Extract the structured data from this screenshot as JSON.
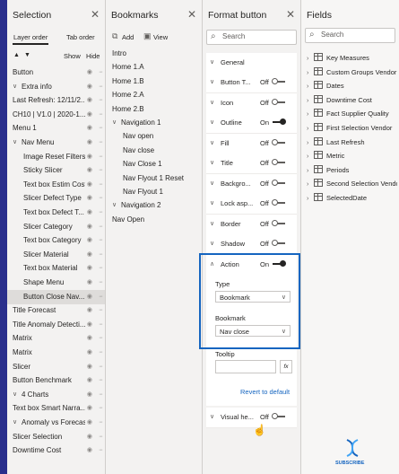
{
  "selection": {
    "title": "Selection",
    "tabs": [
      "Layer order",
      "Tab order"
    ],
    "show_label": "Show",
    "hide_label": "Hide",
    "items": [
      {
        "label": "Button",
        "indent": 0,
        "chev": ""
      },
      {
        "label": "Extra info",
        "indent": 0,
        "chev": "v"
      },
      {
        "label": "Last Refresh: 12/11/2...",
        "indent": 0,
        "chev": ""
      },
      {
        "label": "CH10 | V1.0 | 2020-1...",
        "indent": 0,
        "chev": ""
      },
      {
        "label": "Menu 1",
        "indent": 0,
        "chev": ""
      },
      {
        "label": "Nav Menu",
        "indent": 0,
        "chev": "v"
      },
      {
        "label": "Image Reset Filters",
        "indent": 1,
        "chev": ""
      },
      {
        "label": "Sticky Slicer",
        "indent": 1,
        "chev": ""
      },
      {
        "label": "Text box Estim Cost",
        "indent": 1,
        "chev": ""
      },
      {
        "label": "Slicer Defect Type",
        "indent": 1,
        "chev": ""
      },
      {
        "label": "Text box Defect T...",
        "indent": 1,
        "chev": ""
      },
      {
        "label": "Slicer Category",
        "indent": 1,
        "chev": ""
      },
      {
        "label": "Text box Category",
        "indent": 1,
        "chev": ""
      },
      {
        "label": "Slicer Material",
        "indent": 1,
        "chev": ""
      },
      {
        "label": "Text box Material",
        "indent": 1,
        "chev": ""
      },
      {
        "label": "Shape Menu",
        "indent": 1,
        "chev": ""
      },
      {
        "label": "Button Close Nav...",
        "indent": 1,
        "chev": "",
        "selected": true
      },
      {
        "label": "Title Forecast",
        "indent": 0,
        "chev": ""
      },
      {
        "label": "Title Anomaly Detecti...",
        "indent": 0,
        "chev": ""
      },
      {
        "label": "Matrix",
        "indent": 0,
        "chev": ""
      },
      {
        "label": "Matrix",
        "indent": 0,
        "chev": ""
      },
      {
        "label": "Slicer",
        "indent": 0,
        "chev": ""
      },
      {
        "label": "Button Benchmark",
        "indent": 0,
        "chev": ""
      },
      {
        "label": "4 Charts",
        "indent": 0,
        "chev": "v"
      },
      {
        "label": "Text box Smart Narra...",
        "indent": 0,
        "chev": ""
      },
      {
        "label": "Anomaly vs Forecast",
        "indent": 0,
        "chev": "v"
      },
      {
        "label": "Slicer Selection",
        "indent": 0,
        "chev": ""
      },
      {
        "label": "Downtime Cost",
        "indent": 0,
        "chev": ""
      }
    ]
  },
  "bookmarks": {
    "title": "Bookmarks",
    "add_label": "Add",
    "view_label": "View",
    "items": [
      {
        "label": "Intro",
        "indent": 0,
        "chev": ""
      },
      {
        "label": "Home 1.A",
        "indent": 0,
        "chev": ""
      },
      {
        "label": "Home 1.B",
        "indent": 0,
        "chev": ""
      },
      {
        "label": "Home 2.A",
        "indent": 0,
        "chev": ""
      },
      {
        "label": "Home 2.B",
        "indent": 0,
        "chev": ""
      },
      {
        "label": "Navigation 1",
        "indent": 0,
        "chev": "v"
      },
      {
        "label": "Nav open",
        "indent": 1,
        "chev": ""
      },
      {
        "label": "Nav close",
        "indent": 1,
        "chev": ""
      },
      {
        "label": "Nav Close 1",
        "indent": 1,
        "chev": ""
      },
      {
        "label": "Nav Flyout 1 Reset",
        "indent": 1,
        "chev": ""
      },
      {
        "label": "Nav Flyout 1",
        "indent": 1,
        "chev": ""
      },
      {
        "label": "Navigation 2",
        "indent": 0,
        "chev": "v"
      },
      {
        "label": "Nav Open",
        "indent": 0,
        "chev": ""
      }
    ]
  },
  "format": {
    "title": "Format button",
    "search_placeholder": "Search",
    "general_label": "General",
    "cards": [
      {
        "label": "Button T...",
        "state": "Off",
        "on": false
      },
      {
        "label": "Icon",
        "state": "Off",
        "on": false
      },
      {
        "label": "Outline",
        "state": "On",
        "on": true
      },
      {
        "label": "Fill",
        "state": "Off",
        "on": false
      },
      {
        "label": "Title",
        "state": "Off",
        "on": false
      },
      {
        "label": "Backgro...",
        "state": "Off",
        "on": false
      },
      {
        "label": "Lock asp...",
        "state": "Off",
        "on": false
      },
      {
        "label": "Border",
        "state": "Off",
        "on": false
      },
      {
        "label": "Shadow",
        "state": "Off",
        "on": false
      }
    ],
    "action": {
      "label": "Action",
      "state": "On",
      "type_label": "Type",
      "type_value": "Bookmark",
      "bookmark_label": "Bookmark",
      "bookmark_value": "Nav close",
      "tooltip_label": "Tooltip",
      "fx_label": "fx",
      "revert_label": "Revert to default"
    },
    "visual_header": {
      "label": "Visual he...",
      "state": "Off"
    }
  },
  "fields": {
    "title": "Fields",
    "search_placeholder": "Search",
    "items": [
      {
        "label": "Key Measures",
        "icon": "table-icon"
      },
      {
        "label": "Custom Groups Vendor",
        "icon": "table-icon"
      },
      {
        "label": "Dates",
        "icon": "table-icon"
      },
      {
        "label": "Downtime Cost",
        "icon": "table-icon"
      },
      {
        "label": "Fact Supplier Quality",
        "icon": "table-icon"
      },
      {
        "label": "First Selection Vendor",
        "icon": "table-icon"
      },
      {
        "label": "Last Refresh",
        "icon": "table-icon"
      },
      {
        "label": "Metric",
        "icon": "table-icon"
      },
      {
        "label": "Periods",
        "icon": "table-icon"
      },
      {
        "label": "Second Selection Vendor",
        "icon": "table-icon"
      },
      {
        "label": "SelectedDate",
        "icon": "table-icon"
      }
    ]
  },
  "subscribe_label": "SUBSCRIBE",
  "colors": {
    "accent": "#1565c0",
    "strip": "#2a2f8c"
  }
}
